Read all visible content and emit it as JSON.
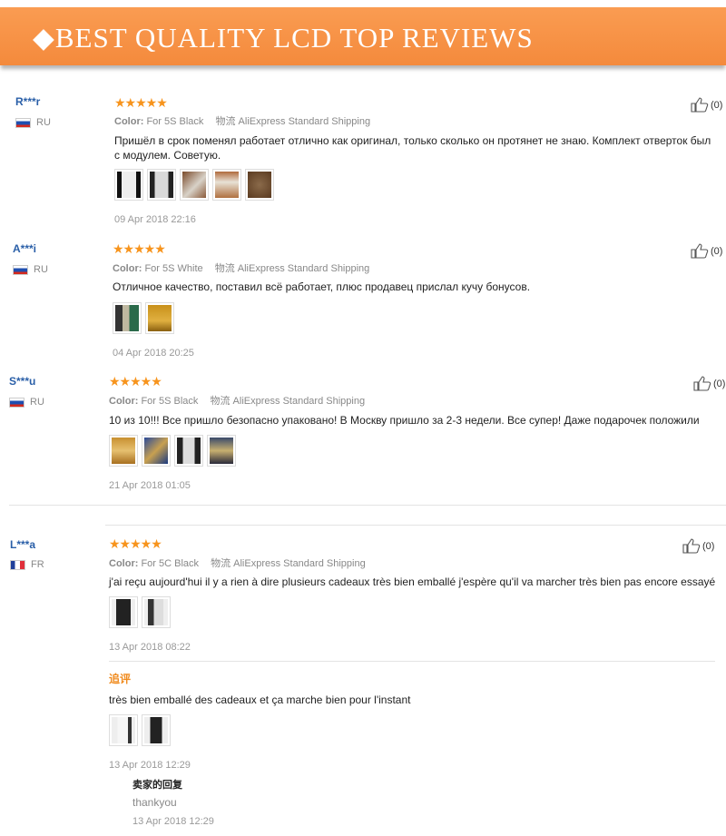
{
  "banner": {
    "title": "◆BEST QUALITY LCD TOP REVIEWS"
  },
  "labels": {
    "color": "Color:",
    "shipping": "物流",
    "stars": "★★★★★",
    "followup": "追评",
    "seller_reply": "卖家的回复"
  },
  "colors": {
    "banner": "#f7903f",
    "star": "#f7941d",
    "username": "#2a5fa8",
    "followup": "#f08a1c"
  },
  "reviews": [
    {
      "user": "R***r",
      "country": "RU",
      "flag": "ru",
      "color_value": "For 5S Black",
      "shipping_value": "AliExpress Standard Shipping",
      "text": "Пришёл в срок поменял работает отлично как оригинал, только сколько он протянет не знаю. Комплект отверток был с модулем. Советую.",
      "date": "09 Apr 2018 22:16",
      "likes": "(0)"
    },
    {
      "user": "A***i",
      "country": "RU",
      "flag": "ru",
      "color_value": "For 5S White",
      "shipping_value": "AliExpress Standard Shipping",
      "text": "Отличное качество, поставил всё работает, плюс продавец прислал кучу бонусов.",
      "date": "04 Apr 2018 20:25",
      "likes": "(0)"
    },
    {
      "user": "S***u",
      "country": "RU",
      "flag": "ru",
      "color_value": "For 5S Black",
      "shipping_value": "AliExpress Standard Shipping",
      "text": "10 из 10!!! Все пришло безопасно упаковано! В Москву пришло за 2-3 недели. Все супер! Даже подарочек положили",
      "date": "21 Apr 2018 01:05",
      "likes": "(0)"
    },
    {
      "user": "L***a",
      "country": "FR",
      "flag": "fr",
      "color_value": "For 5C Black",
      "shipping_value": "AliExpress Standard Shipping",
      "text": "j'ai reçu aujourd'hui il y a rien à dire plusieurs cadeaux très bien emballé j'espère qu'il va marcher très bien pas encore essayé",
      "date": "13 Apr 2018 08:22",
      "likes": "(0)",
      "followup": {
        "text": "très bien emballé des cadeaux et ça marche bien pour l'instant",
        "date": "13 Apr 2018 12:29"
      },
      "seller": {
        "text": "thankyou",
        "date": "13 Apr 2018 12:29"
      }
    }
  ]
}
